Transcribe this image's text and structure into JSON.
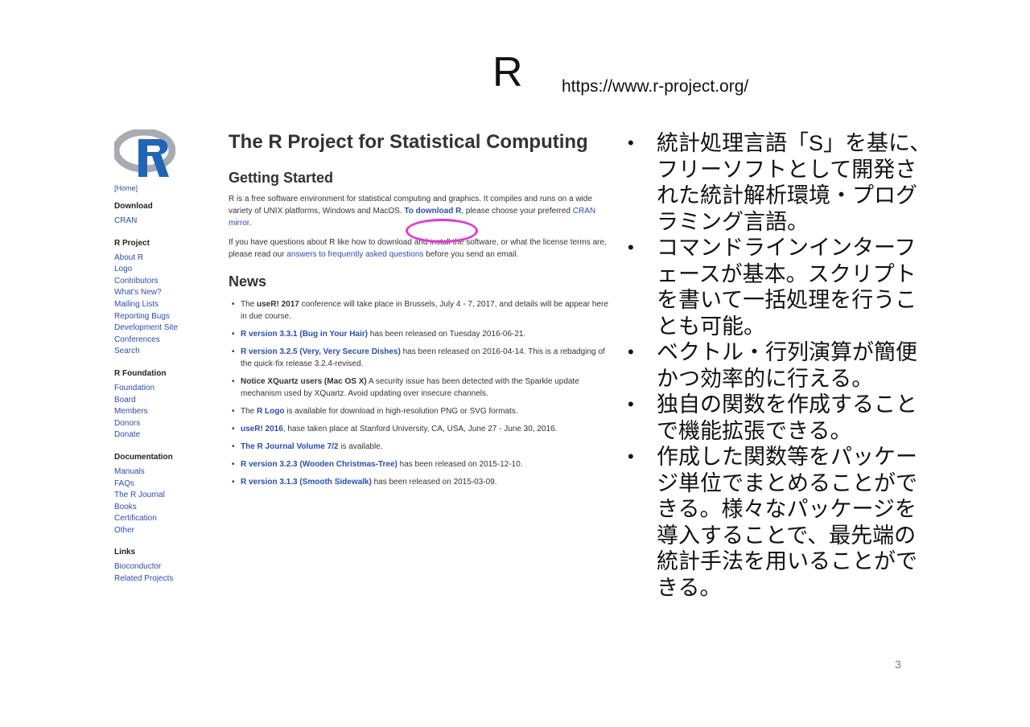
{
  "slide": {
    "title": "R",
    "url": "https://www.r-project.org/",
    "page_number": "3"
  },
  "screenshot": {
    "sidebar": {
      "home": "[Home]",
      "sections": [
        {
          "heading": "Download",
          "links": [
            "CRAN"
          ]
        },
        {
          "heading": "R Project",
          "links": [
            "About R",
            "Logo",
            "Contributors",
            "What's New?",
            "Mailing Lists",
            "Reporting Bugs",
            "Development Site",
            "Conferences",
            "Search"
          ]
        },
        {
          "heading": "R Foundation",
          "links": [
            "Foundation",
            "Board",
            "Members",
            "Donors",
            "Donate"
          ]
        },
        {
          "heading": "Documentation",
          "links": [
            "Manuals",
            "FAQs",
            "The R Journal",
            "Books",
            "Certification",
            "Other"
          ]
        },
        {
          "heading": "Links",
          "links": [
            "Bioconductor",
            "Related Projects"
          ]
        }
      ]
    },
    "main": {
      "title": "The R Project for Statistical Computing",
      "getting_started": {
        "heading": "Getting Started",
        "p1_a": "R is a free software environment for statistical computing and graphics. It compiles and runs on a wide variety of UNIX platforms, Windows and MacOS. ",
        "p1_link": "To download R",
        "p1_b": ", please choose your preferred ",
        "p1_link2": "CRAN mirror",
        "p1_c": ".",
        "p2_a": "If you have questions about R like how to download and install the software, or what the license terms are, please read our ",
        "p2_link": "answers to frequently asked questions",
        "p2_b": " before you send an email."
      },
      "news_heading": "News",
      "news": [
        {
          "pre": "The ",
          "link": "",
          "bold": "useR! 2017",
          "post": " conference will take place in Brussels, July 4 - 7, 2017, and details will be appear here in due course."
        },
        {
          "pre": "",
          "link": "R version 3.3.1 (Bug in Your Hair)",
          "bold": "",
          "post": " has been released on Tuesday 2016-06-21."
        },
        {
          "pre": "",
          "link": "R version 3.2.5 (Very, Very Secure Dishes)",
          "bold": "",
          "post": " has been released on 2016-04-14. This is a rebadging of the quick-fix release 3.2.4-revised."
        },
        {
          "pre": "",
          "link": "",
          "bold": "Notice XQuartz users (Mac OS X)",
          "post": " A security issue has been detected with the Sparkle update mechanism used by XQuartz. Avoid updating over insecure channels."
        },
        {
          "pre": "The ",
          "link": "R Logo",
          "bold": "",
          "post": " is available for download in high-resolution PNG or SVG formats."
        },
        {
          "pre": "",
          "link": "useR! 2016",
          "bold": "",
          "post": ", hase taken place at Stanford University, CA, USA, June 27 - June 30, 2016."
        },
        {
          "pre": "",
          "link": "The R Journal Volume 7/2",
          "bold": "",
          "post": " is available."
        },
        {
          "pre": "",
          "link": "R version 3.2.3 (Wooden Christmas-Tree)",
          "bold": "",
          "post": " has been released on 2015-12-10."
        },
        {
          "pre": "",
          "link": "R version 3.1.3 (Smooth Sidewalk)",
          "bold": "",
          "post": " has been released on 2015-03-09."
        }
      ]
    }
  },
  "bullets": [
    "統計処理言語「S」を基に、フリーソフトとして開発された統計解析環境・プログラミング言語。",
    "コマンドラインインターフェースが基本。スクリプトを書いて一括処理を行うことも可能。",
    "ベクトル・行列演算が簡便かつ効率的に行える。",
    "独自の関数を作成することで機能拡張できる。",
    "作成した関数等をパッケージ単位でまとめることができる。様々なパッケージを導入することで、最先端の統計手法を用いることができる。"
  ],
  "colors": {
    "link": "#2b4dab",
    "highlight_circle": "#e337d3",
    "logo_blue": "#2265b7",
    "logo_gray": "#a9abb3"
  }
}
